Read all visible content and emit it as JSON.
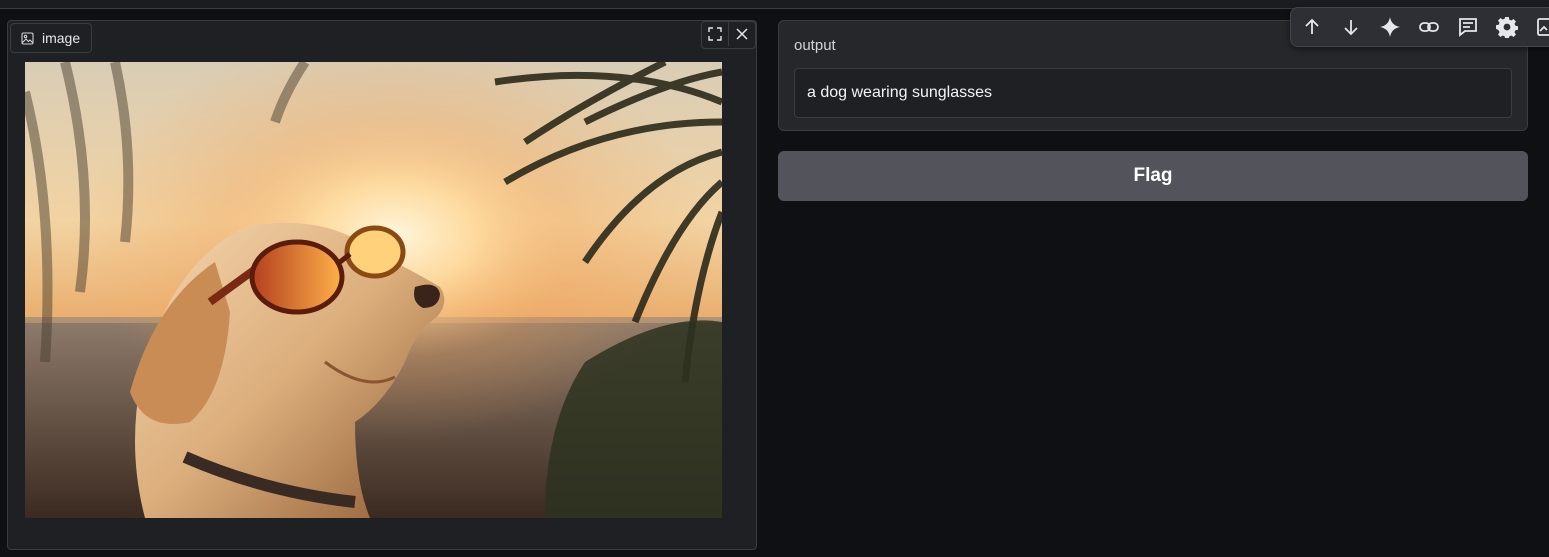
{
  "image_panel": {
    "label": "image",
    "label_icon": "image-icon",
    "controls": [
      {
        "name": "fullscreen-icon"
      },
      {
        "name": "close-icon"
      }
    ]
  },
  "output": {
    "label": "output",
    "value": "a dog wearing sunglasses"
  },
  "flag_button": {
    "label": "Flag"
  },
  "toolbar": {
    "icons": [
      "arrow-up-icon",
      "arrow-down-icon",
      "sparkle-icon",
      "link-icon",
      "comment-icon",
      "gear-icon",
      "image-edit-icon"
    ]
  },
  "colors": {
    "background": "#0f1013",
    "panel": "#26272b",
    "button": "#52535b",
    "border": "#3a3c42"
  }
}
